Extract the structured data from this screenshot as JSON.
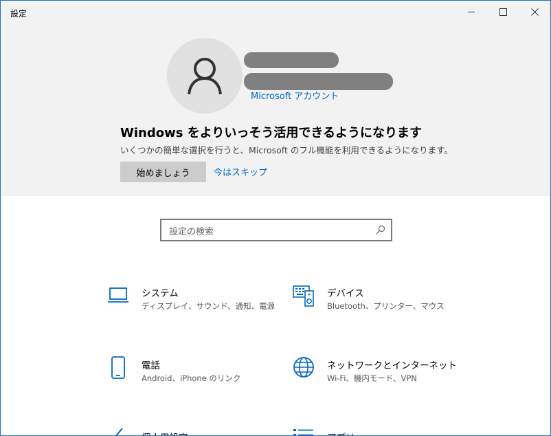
{
  "window": {
    "title": "設定"
  },
  "account": {
    "link": "Microsoft アカウント"
  },
  "promo": {
    "title": "Windows をよりいっそう活用できるようになります",
    "subtitle": "いくつかの簡単な選択を行うと、Microsoft のフル機能を利用できるようになります。",
    "start_button": "始めましょう",
    "skip_link": "今はスキップ"
  },
  "search": {
    "placeholder": "設定の検索"
  },
  "tiles": [
    {
      "name": "システム",
      "desc": "ディスプレイ、サウンド、通知、電源",
      "icon": "laptop-icon"
    },
    {
      "name": "デバイス",
      "desc": "Bluetooth、プリンター、マウス",
      "icon": "devices-icon"
    },
    {
      "name": "電話",
      "desc": "Android、iPhone のリンク",
      "icon": "phone-icon"
    },
    {
      "name": "ネットワークとインターネット",
      "desc": "Wi-Fi、機内モード、VPN",
      "icon": "globe-icon"
    },
    {
      "name": "個人用設定",
      "desc": "",
      "icon": "brush-icon"
    },
    {
      "name": "アプリ",
      "desc": "",
      "icon": "apps-icon"
    }
  ],
  "colors": {
    "accent": "#0067c0",
    "banner_bg": "#f2f2f2"
  }
}
